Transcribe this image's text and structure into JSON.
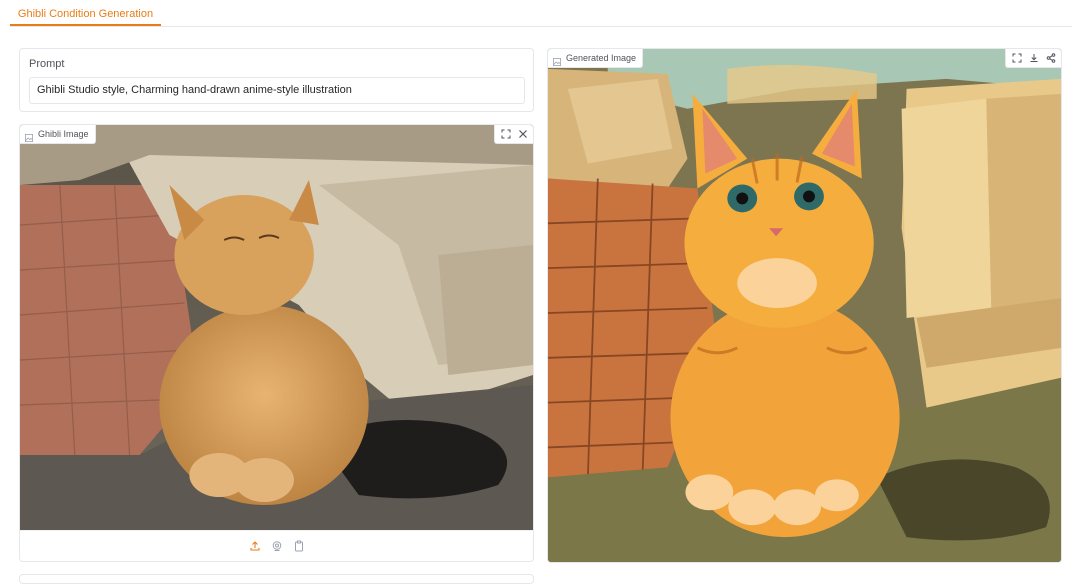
{
  "tabs": [
    {
      "label": "Ghibli Condition Generation",
      "active": true
    }
  ],
  "prompt": {
    "label": "Prompt",
    "value": "Ghibli Studio style, Charming hand-drawn anime-style illustration"
  },
  "input_image": {
    "label": "Ghibli Image",
    "toolbar_icons": [
      "fullscreen-icon",
      "close-icon"
    ],
    "bottom_icons": [
      "upload-icon",
      "webcam-icon",
      "clipboard-icon"
    ]
  },
  "output_image": {
    "label": "Generated Image",
    "toolbar_icons": [
      "fullscreen-icon",
      "download-icon",
      "share-icon"
    ]
  },
  "colors": {
    "accent": "#ea7c17",
    "border": "#e5e7eb"
  }
}
